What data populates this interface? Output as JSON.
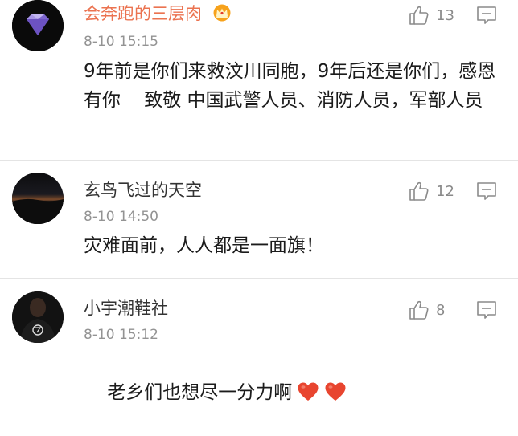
{
  "comments": [
    {
      "username": "会奔跑的三层肉",
      "username_style": "vip",
      "badge_icon": "vip-crown-icon",
      "timestamp": "8-10 15:15",
      "text": "9年前是你们来救汶川同胞，9年后还是你们，感恩有你    致敬 中国武警人员、消防人员，军部人员",
      "like_count": "13"
    },
    {
      "username": "玄鸟飞过的天空",
      "username_style": "normal",
      "timestamp": "8-10 14:50",
      "text": "灾难面前，人人都是一面旗！",
      "like_count": "12"
    },
    {
      "username": "小宇潮鞋社",
      "username_style": "normal",
      "timestamp": "8-10 15:12",
      "text": "老乡们也想尽一分力啊",
      "trailing_emoji": [
        "heart-icon",
        "heart-icon"
      ],
      "like_count": "8"
    }
  ],
  "colors": {
    "vip_name": "#eb7350",
    "normal_name": "#333333",
    "timestamp": "#939393",
    "heart": "#e8452f",
    "icon_gray": "#8a8a8a"
  }
}
